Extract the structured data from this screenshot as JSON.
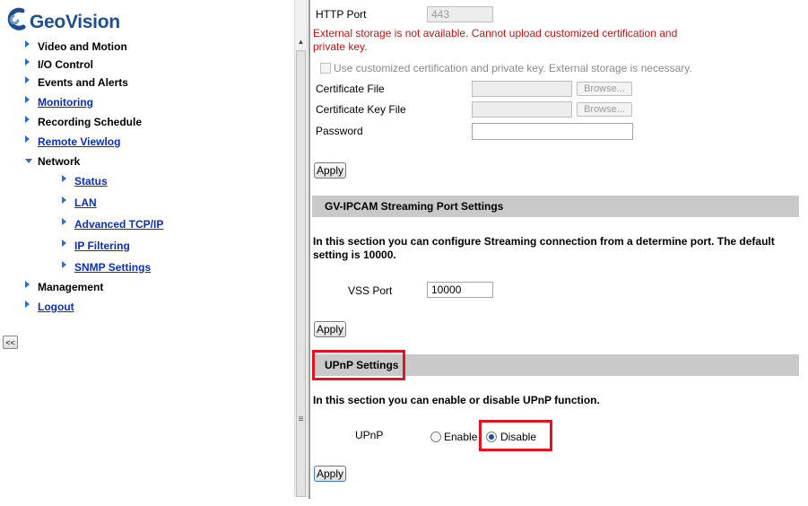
{
  "logo": {
    "text": "GeoVision"
  },
  "nav": {
    "items": [
      {
        "label": "Video and Motion"
      },
      {
        "label": "I/O Control"
      },
      {
        "label": "Events and Alerts"
      },
      {
        "label": "Monitoring"
      },
      {
        "label": "Recording Schedule"
      },
      {
        "label": "Remote Viewlog"
      },
      {
        "label": "Network"
      },
      {
        "label": "Status"
      },
      {
        "label": "LAN"
      },
      {
        "label": "Advanced TCP/IP"
      },
      {
        "label": "IP Filtering"
      },
      {
        "label": "SNMP Settings"
      },
      {
        "label": "Management"
      },
      {
        "label": "Logout"
      }
    ],
    "collapse_label": "<<"
  },
  "https": {
    "port_label": "HTTP Port",
    "port_value": "443",
    "warning_line1": "External storage is not available. Cannot upload customized certification and",
    "warning_line2": "private key.",
    "use_custom_label": "Use customized certification and private key. External storage is necessary.",
    "certificate_file_label": "Certificate File",
    "certificate_key_file_label": "Certificate Key File",
    "password_label": "Password",
    "browse_label": "Browse...",
    "apply_label": "Apply"
  },
  "streaming": {
    "header": "GV-IPCAM Streaming Port Settings",
    "description_line1": "In this section you can configure Streaming connection from a determine port. The default",
    "description_line2": "setting is 10000.",
    "vss_port_label": "VSS Port",
    "vss_port_value": "10000",
    "apply_label": "Apply"
  },
  "upnp": {
    "header": "UPnP Settings",
    "description": "In this section you can enable or disable UPnP function.",
    "label": "UPnP",
    "enable_label": "Enable",
    "disable_label": "Disable",
    "selected": "Disable",
    "apply_label": "Apply"
  },
  "colors": {
    "link": "#0a2fb8",
    "warning": "#cc1010",
    "highlight": "#e3141f",
    "section_bar": "#c9c9c9",
    "logo": "#1f4e8c"
  }
}
